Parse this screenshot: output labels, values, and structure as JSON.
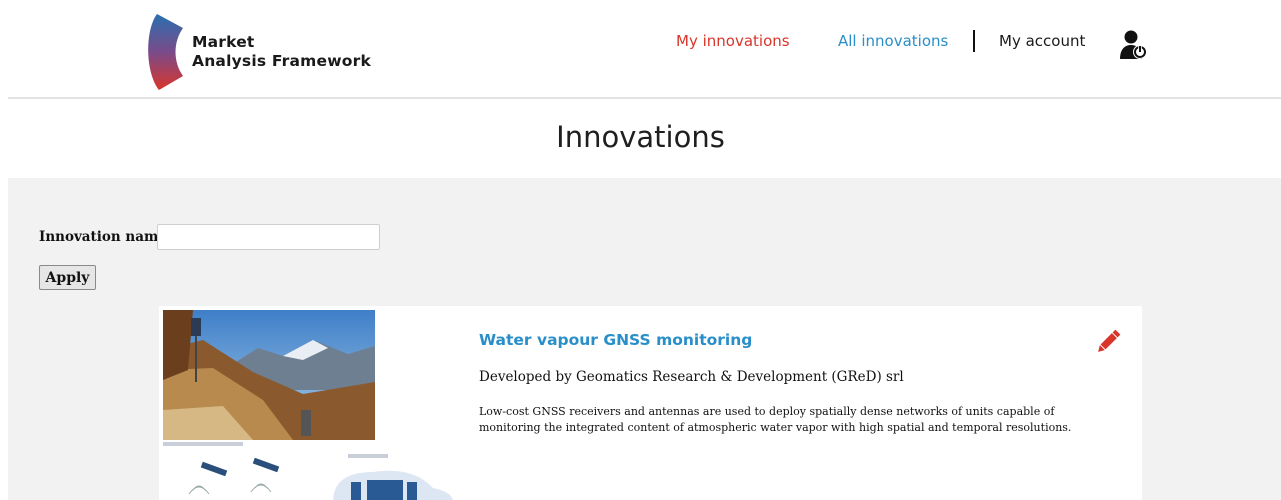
{
  "brand": {
    "line1": "Market",
    "line2": "Analysis Framework"
  },
  "nav": {
    "my_innovations": "My innovations",
    "all_innovations": "All innovations",
    "my_account": "My account"
  },
  "colors": {
    "accent_red": "#d9352a",
    "accent_blue": "#2a8ec9",
    "panel_bg": "#f2f2f2"
  },
  "icons": {
    "logo": "shield-logo",
    "account": "user-power-icon",
    "edit": "pencil-icon"
  },
  "page": {
    "title": "Innovations"
  },
  "filter": {
    "label": "Innovation name",
    "value": "",
    "apply_label": "Apply"
  },
  "innovations": [
    {
      "title": "Water vapour GNSS monitoring",
      "developer": "Developed by Geomatics Research & Development (GReD) srl",
      "description": "Low-cost GNSS receivers and antennas are used to deploy spatially dense networks of units capable of monitoring the integrated content of atmospheric water vapor with high spatial and temporal resolutions."
    }
  ]
}
